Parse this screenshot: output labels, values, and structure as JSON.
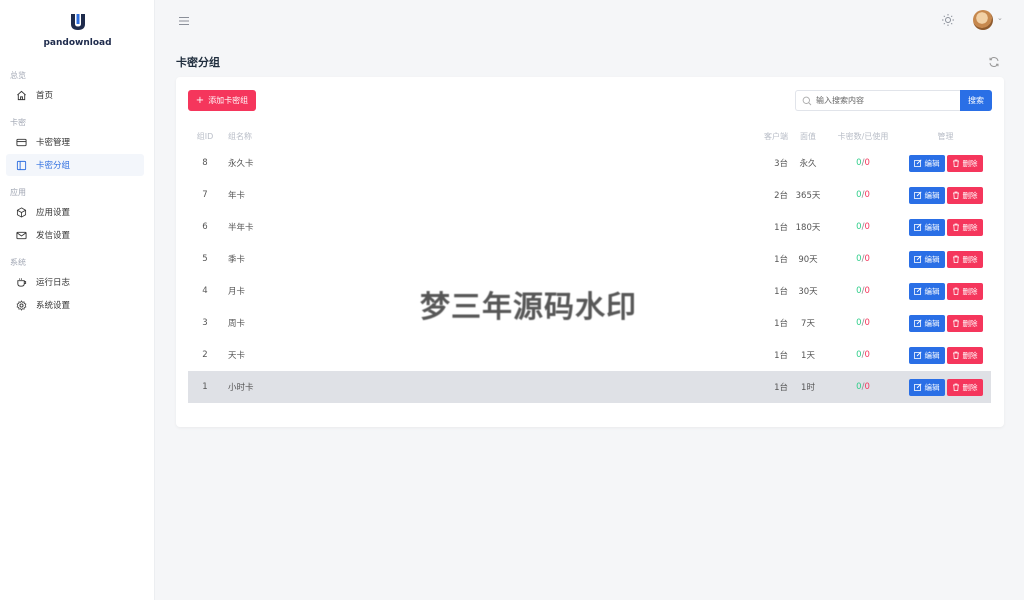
{
  "app": {
    "name": "pandownload"
  },
  "sidebar": {
    "sections": [
      {
        "title": "总览",
        "items": [
          {
            "label": "首页",
            "icon": "home-icon"
          }
        ]
      },
      {
        "title": "卡密",
        "items": [
          {
            "label": "卡密管理",
            "icon": "card-icon"
          },
          {
            "label": "卡密分组",
            "icon": "sidebar-layout-icon",
            "active": true
          }
        ]
      },
      {
        "title": "应用",
        "items": [
          {
            "label": "应用设置",
            "icon": "box-icon"
          },
          {
            "label": "发信设置",
            "icon": "mail-icon"
          }
        ]
      },
      {
        "title": "系统",
        "items": [
          {
            "label": "运行日志",
            "icon": "cup-icon"
          },
          {
            "label": "系统设置",
            "icon": "gear-icon"
          }
        ]
      }
    ]
  },
  "page": {
    "title": "卡密分组"
  },
  "toolbar": {
    "add_label": "添加卡密组",
    "search_placeholder": "输入搜索内容",
    "search_label": "搜索"
  },
  "table": {
    "headers": [
      "组ID",
      "组名称",
      "客户端",
      "面值",
      "卡密数/已使用",
      "管理"
    ],
    "rows": [
      {
        "id": "8",
        "name": "永久卡",
        "devices": "3台",
        "face": "永久",
        "count": "0",
        "used": "0"
      },
      {
        "id": "7",
        "name": "年卡",
        "devices": "2台",
        "face": "365天",
        "count": "0",
        "used": "0"
      },
      {
        "id": "6",
        "name": "半年卡",
        "devices": "1台",
        "face": "180天",
        "count": "0",
        "used": "0"
      },
      {
        "id": "5",
        "name": "季卡",
        "devices": "1台",
        "face": "90天",
        "count": "0",
        "used": "0"
      },
      {
        "id": "4",
        "name": "月卡",
        "devices": "1台",
        "face": "30天",
        "count": "0",
        "used": "0"
      },
      {
        "id": "3",
        "name": "周卡",
        "devices": "1台",
        "face": "7天",
        "count": "0",
        "used": "0"
      },
      {
        "id": "2",
        "name": "天卡",
        "devices": "1台",
        "face": "1天",
        "count": "0",
        "used": "0"
      },
      {
        "id": "1",
        "name": "小时卡",
        "devices": "1台",
        "face": "1时",
        "count": "0",
        "used": "0"
      }
    ],
    "edit_label": "编辑",
    "delete_label": "删除",
    "separator": "/"
  },
  "watermark": "梦三年源码水印",
  "colors": {
    "primary": "#2a6fe6",
    "danger": "#f5365c",
    "success": "#2dce89",
    "brand": "#1e2b4c"
  }
}
